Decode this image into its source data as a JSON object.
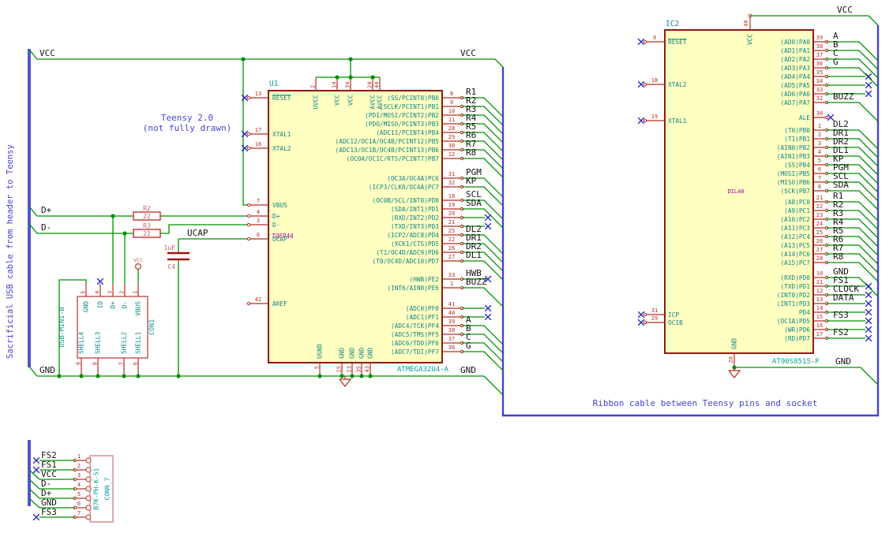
{
  "colors": {
    "wire_green": "#009100",
    "pin_red": "#b92b21",
    "body_stroke": "#8e1a14",
    "body_fill": "#ffffc2",
    "name_teal": "#0e8585",
    "ref_teal": "#0d9a9c",
    "footprint_magenta": "#a400a4",
    "note_blue": "#4545cf",
    "cable_blue": "#5353cf",
    "noconnect_blue": "#2a2ac8",
    "label_black": "#141414",
    "passive_red": "#bf5f5f",
    "plate_red": "#a01010"
  },
  "notes": {
    "cable": "Sacrificial USB cable from header to Teensy",
    "teensy1": "Teensy 2.0",
    "teensy2": "(not fully drawn)",
    "ribbon": "Ribbon cable between Teensy pins and socket"
  },
  "net_labels": {
    "vcc": "VCC",
    "gnd": "GND",
    "dplus": "D+",
    "dminus": "D-",
    "ucap": "UCAP"
  },
  "u1": {
    "ref": "U1",
    "value": "ATMEGA32U4-A",
    "footprint": "TQFP44",
    "left": [
      {
        "num": "13",
        "name": "RESET",
        "bar": true,
        "nc": true
      },
      {
        "num": "17",
        "name": "XTAL1",
        "nc": true
      },
      {
        "num": "16",
        "name": "XTAL2",
        "nc": true
      },
      {
        "num": "7",
        "name": "VBUS"
      },
      {
        "num": "4",
        "name": "D+"
      },
      {
        "num": "3",
        "name": "D-"
      },
      {
        "num": "6",
        "name": "UCAP"
      },
      {
        "num": "42",
        "name": "AREF"
      }
    ],
    "top": [
      {
        "num": "2",
        "name": "UVCC"
      },
      {
        "num": "14",
        "name": "VCC"
      },
      {
        "num": "34",
        "name": "VCC"
      },
      {
        "num": "24",
        "name": "AVCC"
      },
      {
        "num": "44",
        "name": "AVCC"
      }
    ],
    "bottom": [
      {
        "num": "5",
        "name": "UGND"
      },
      {
        "num": "15",
        "name": "GND"
      },
      {
        "num": "23",
        "name": "GND"
      },
      {
        "num": "35",
        "name": "GND"
      },
      {
        "num": "43",
        "name": "GND"
      }
    ],
    "right": [
      {
        "num": "8",
        "name": "(SS/PCINT0)PB0",
        "label": "R1",
        "conn": "bus"
      },
      {
        "num": "9",
        "name": "(SCLK/PCINT1)PB1",
        "label": "R2",
        "conn": "bus"
      },
      {
        "num": "10",
        "name": "(PDI/MOSI/PCINT2)PB2",
        "label": "R3",
        "conn": "bus"
      },
      {
        "num": "11",
        "name": "(PDO/MISO/PCINT3)PB3",
        "label": "R4",
        "conn": "bus"
      },
      {
        "num": "28",
        "name": "(ADC11/PCINT4)PB4",
        "label": "R5",
        "conn": "bus"
      },
      {
        "num": "29",
        "name": "(ADC12/OC1A/OC4B/PCINT12)PB5",
        "label": "R6",
        "conn": "bus"
      },
      {
        "num": "30",
        "name": "(ADC13/OC1B/OC4B/PCINT13)PB6",
        "label": "R7",
        "conn": "bus"
      },
      {
        "num": "12",
        "name": "(OC0A/OC1C/RTS/PCINT7)PB7",
        "label": "R8",
        "conn": "bus"
      },
      {
        "num": "31",
        "name": "(OC3A/OC4A)PC6",
        "label": "PGM",
        "conn": "bus"
      },
      {
        "num": "32",
        "name": "(ICP3/CLK0/OC4A)PC7",
        "label": "KP",
        "conn": "bus"
      },
      {
        "num": "18",
        "name": "(OC0B/SCL/INT0)PD0",
        "label": "SCL",
        "conn": "bus"
      },
      {
        "num": "19",
        "name": "(SDA/INT1)PD1",
        "label": "SDA",
        "conn": "bus"
      },
      {
        "num": "20",
        "name": "(RXD/INT2)PD2",
        "label": "",
        "conn": "nc"
      },
      {
        "num": "21",
        "name": "(TXD/INT3)PD3",
        "label": "",
        "conn": "nc"
      },
      {
        "num": "25",
        "name": "(ICP2/ADC8)PD4",
        "label": "DL2",
        "conn": "bus"
      },
      {
        "num": "22",
        "name": "(XCK1/CTS)PD5",
        "label": "DR1",
        "conn": "bus"
      },
      {
        "num": "26",
        "name": "(T1/OC4D/ADC9)PD6",
        "label": "DR2",
        "conn": "bus"
      },
      {
        "num": "27",
        "name": "(T0/OC4D/ADC10)PD7",
        "label": "DL1",
        "conn": "bus"
      },
      {
        "num": "33",
        "name": "(HWB)PE2",
        "label": "HWB",
        "conn": "nc"
      },
      {
        "num": "1",
        "name": "(INT6/AIN0)PE6",
        "label": "BUZZ",
        "conn": "bus"
      },
      {
        "num": "41",
        "name": "(ADC0)PF0",
        "label": "",
        "conn": "nc"
      },
      {
        "num": "40",
        "name": "(ADC1)PF1",
        "label": "",
        "conn": "nc"
      },
      {
        "num": "39",
        "name": "(ADC4/TCK)PF4",
        "label": "A",
        "conn": "bus"
      },
      {
        "num": "38",
        "name": "(ADC5/TMS)PF5",
        "label": "B",
        "conn": "bus"
      },
      {
        "num": "37",
        "name": "(ADC6/TDO)PF6",
        "label": "C",
        "conn": "bus"
      },
      {
        "num": "36",
        "name": "(ADC7/TDI)PF7",
        "label": "G",
        "conn": "bus"
      }
    ]
  },
  "ic2": {
    "ref": "IC2",
    "value": "AT90S8515-P",
    "footprint": "DIL40",
    "left": [
      {
        "num": "9",
        "name": "RESET",
        "bar": true,
        "nc": true
      },
      {
        "num": "18",
        "name": "XTAL2",
        "nc": true
      },
      {
        "num": "19",
        "name": "XTAL1",
        "nc": true
      },
      {
        "num": "31",
        "name": "ICP",
        "nc": true
      },
      {
        "num": "29",
        "name": "OC1B",
        "nc": true
      }
    ],
    "top": {
      "num": "40",
      "name": "VCC"
    },
    "bottom": {
      "num": "20",
      "name": "GND"
    },
    "right": [
      {
        "num": "39",
        "name": "(AD0)PA0",
        "label": "A",
        "conn": "bus"
      },
      {
        "num": "38",
        "name": "(AD1)PA1",
        "label": "B",
        "conn": "bus"
      },
      {
        "num": "37",
        "name": "(AD2)PA2",
        "label": "C",
        "conn": "bus"
      },
      {
        "num": "36",
        "name": "(AD3)PA3",
        "label": "G",
        "conn": "bus"
      },
      {
        "num": "35",
        "name": "(AD4)PA4",
        "label": "",
        "conn": "nclong"
      },
      {
        "num": "34",
        "name": "(AD5)PA5",
        "label": "",
        "conn": "nclong"
      },
      {
        "num": "33",
        "name": "(AD6)PA6",
        "label": "",
        "conn": "nclong"
      },
      {
        "num": "32",
        "name": "(AD7)PA7",
        "label": "BUZZ",
        "conn": "bus"
      },
      {
        "num": "30",
        "name": "ALE",
        "label": "",
        "conn": "ncshort"
      },
      {
        "num": "1",
        "name": "(T0)PB0",
        "label": "DL2",
        "conn": "bus"
      },
      {
        "num": "2",
        "name": "(T1)PB1",
        "label": "DR1",
        "conn": "bus"
      },
      {
        "num": "3",
        "name": "(AIN0)PB2",
        "label": "DR2",
        "conn": "bus"
      },
      {
        "num": "4",
        "name": "(AIN1)PB3",
        "label": "DL1",
        "conn": "bus"
      },
      {
        "num": "5",
        "name": "(SS)PB4",
        "label": "KP",
        "conn": "bus"
      },
      {
        "num": "6",
        "name": "(MOSI)PB5",
        "label": "PGM",
        "conn": "bus"
      },
      {
        "num": "7",
        "name": "(MISO)PB6",
        "label": "SCL",
        "conn": "bus"
      },
      {
        "num": "8",
        "name": "(SCK)PB7",
        "label": "SDA",
        "conn": "bus"
      },
      {
        "num": "21",
        "name": "(A8)PC0",
        "label": "R1",
        "conn": "bus"
      },
      {
        "num": "22",
        "name": "(A9)PC1",
        "label": "R2",
        "conn": "bus"
      },
      {
        "num": "23",
        "name": "(A10)PC2",
        "label": "R3",
        "conn": "bus"
      },
      {
        "num": "24",
        "name": "(A11)PC3",
        "label": "R4",
        "conn": "bus"
      },
      {
        "num": "25",
        "name": "(A12)PC4",
        "label": "R5",
        "conn": "bus"
      },
      {
        "num": "26",
        "name": "(A13)PC5",
        "label": "R6",
        "conn": "bus"
      },
      {
        "num": "27",
        "name": "(A14)PC6",
        "label": "R7",
        "conn": "bus"
      },
      {
        "num": "28",
        "name": "(A15)PC7",
        "label": "R8",
        "conn": "bus"
      },
      {
        "num": "10",
        "name": "(RXD)PD0",
        "label": "GND",
        "conn": "bus"
      },
      {
        "num": "11",
        "name": "(TXD)PD1",
        "label": "FS1",
        "conn": "nclong"
      },
      {
        "num": "12",
        "name": "(INT0)PD2",
        "label": "CLOCK",
        "conn": "nclong"
      },
      {
        "num": "13",
        "name": "(INT1)PD3",
        "label": "DATA",
        "conn": "nclong"
      },
      {
        "num": "14",
        "name": "PD4",
        "label": "",
        "conn": "nclong"
      },
      {
        "num": "15",
        "name": "(OC1A)PD5",
        "label": "FS3",
        "conn": "nclong"
      },
      {
        "num": "16",
        "name": "(WR)PD6",
        "label": "",
        "conn": "nclong"
      },
      {
        "num": "17",
        "name": "(RD)PD7",
        "label": "FS2",
        "conn": "nclong"
      }
    ]
  },
  "r2": {
    "ref": "R2",
    "value": "22"
  },
  "r3": {
    "ref": "R3",
    "value": "22"
  },
  "c4": {
    "ref": "C4",
    "value": "1uF"
  },
  "vcc_symbol": {
    "label": "VCC"
  },
  "con1": {
    "ref": "CON1",
    "value": "USB-MINI-B",
    "top": [
      {
        "num": "5",
        "name": "GND"
      },
      {
        "num": "4",
        "name": "ID",
        "nc": true
      },
      {
        "num": "3",
        "name": "D+"
      },
      {
        "num": "2",
        "name": "D-"
      },
      {
        "num": "1",
        "name": "VBUS"
      }
    ],
    "bottom": [
      {
        "num": "9",
        "name": "SHELL4"
      },
      {
        "num": "8",
        "name": "SHELL3"
      },
      {
        "num": "7",
        "name": "SHELL2"
      },
      {
        "num": "6",
        "name": "SHELL1"
      }
    ]
  },
  "conn7": {
    "ref": "CONN_7",
    "value": "B7K-PH-K-S1",
    "pins": [
      {
        "num": "1",
        "label": "FS2",
        "nc": true
      },
      {
        "num": "2",
        "label": "FS1",
        "nc": true
      },
      {
        "num": "3",
        "label": "VCC"
      },
      {
        "num": "4",
        "label": "D-"
      },
      {
        "num": "5",
        "label": "D+"
      },
      {
        "num": "6",
        "label": "GND"
      },
      {
        "num": "7",
        "label": "FS3",
        "nc": true
      }
    ]
  }
}
